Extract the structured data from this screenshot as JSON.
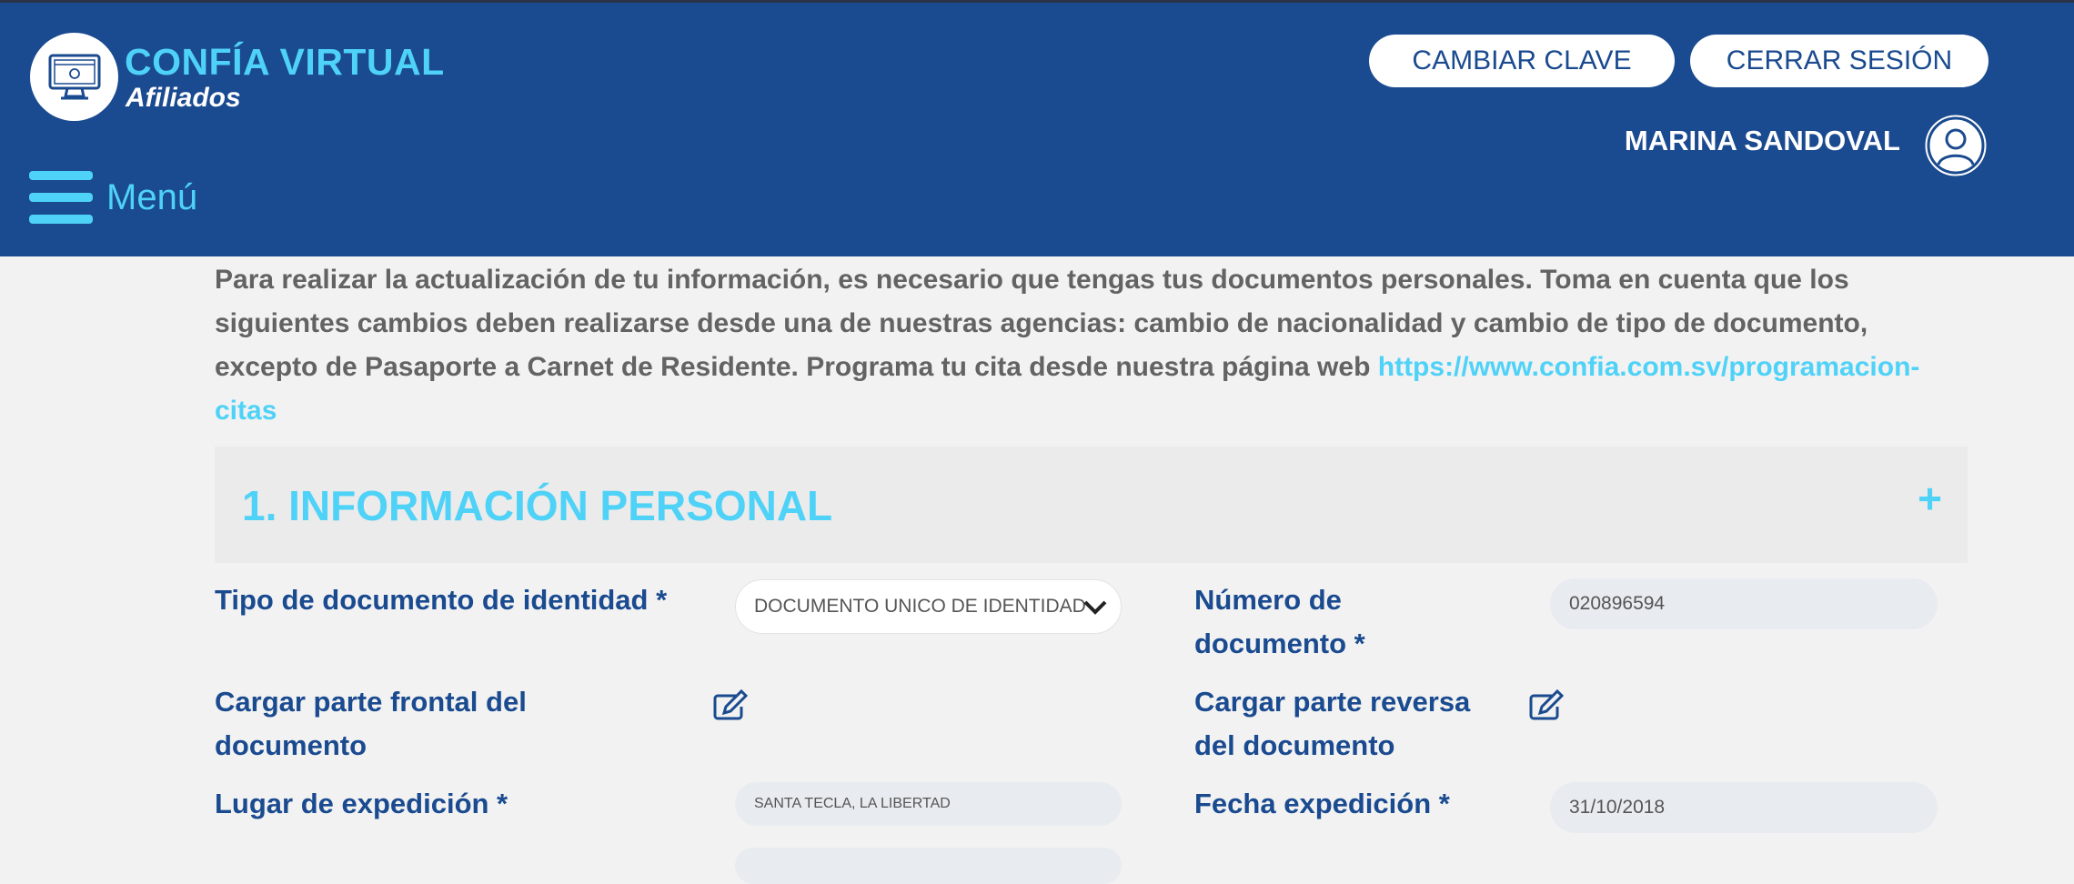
{
  "header": {
    "brand_title": "CONFÍA VIRTUAL",
    "brand_subtitle": "Afiliados",
    "change_password_label": "CAMBIAR CLAVE",
    "logout_label": "CERRAR SESIÓN",
    "user_name": "MARINA SANDOVAL",
    "menu_label": "Menú"
  },
  "intro": {
    "text": "Para realizar la actualización de tu información, es necesario que tengas tus documentos personales. Toma en cuenta que los siguientes cambios deben realizarse desde una de nuestras agencias: cambio de nacionalidad y cambio de tipo de documento, excepto de Pasaporte a Carnet de Residente. Programa tu cita desde nuestra página web ",
    "link_text": "https://www.confia.com.sv/programacion-citas"
  },
  "section": {
    "title": "1. INFORMACIÓN PERSONAL",
    "toggle": "+"
  },
  "form": {
    "doc_type_label": "Tipo de documento de identidad *",
    "doc_type_value": "DOCUMENTO UNICO DE IDENTIDAD",
    "doc_number_label_1": "Número de",
    "doc_number_label_2": "documento *",
    "doc_number_value": "020896594",
    "front_label_1": "Cargar parte frontal del",
    "front_label_2": "documento",
    "back_label_1": "Cargar parte reversa",
    "back_label_2": "del documento",
    "place_label": "Lugar de expedición *",
    "place_value": "SANTA TECLA, LA LIBERTAD",
    "date_label": "Fecha expedición *",
    "date_value": "31/10/2018"
  },
  "colors": {
    "header_bg": "#1a4a8f",
    "accent": "#4fd2f7",
    "label": "#1a4a8f",
    "body_text": "#636363",
    "page_bg": "#f2f2f2"
  },
  "icons": [
    "computer-monitor-icon",
    "hamburger-menu-icon",
    "user-avatar-icon",
    "chevron-down-icon",
    "edit-icon"
  ]
}
